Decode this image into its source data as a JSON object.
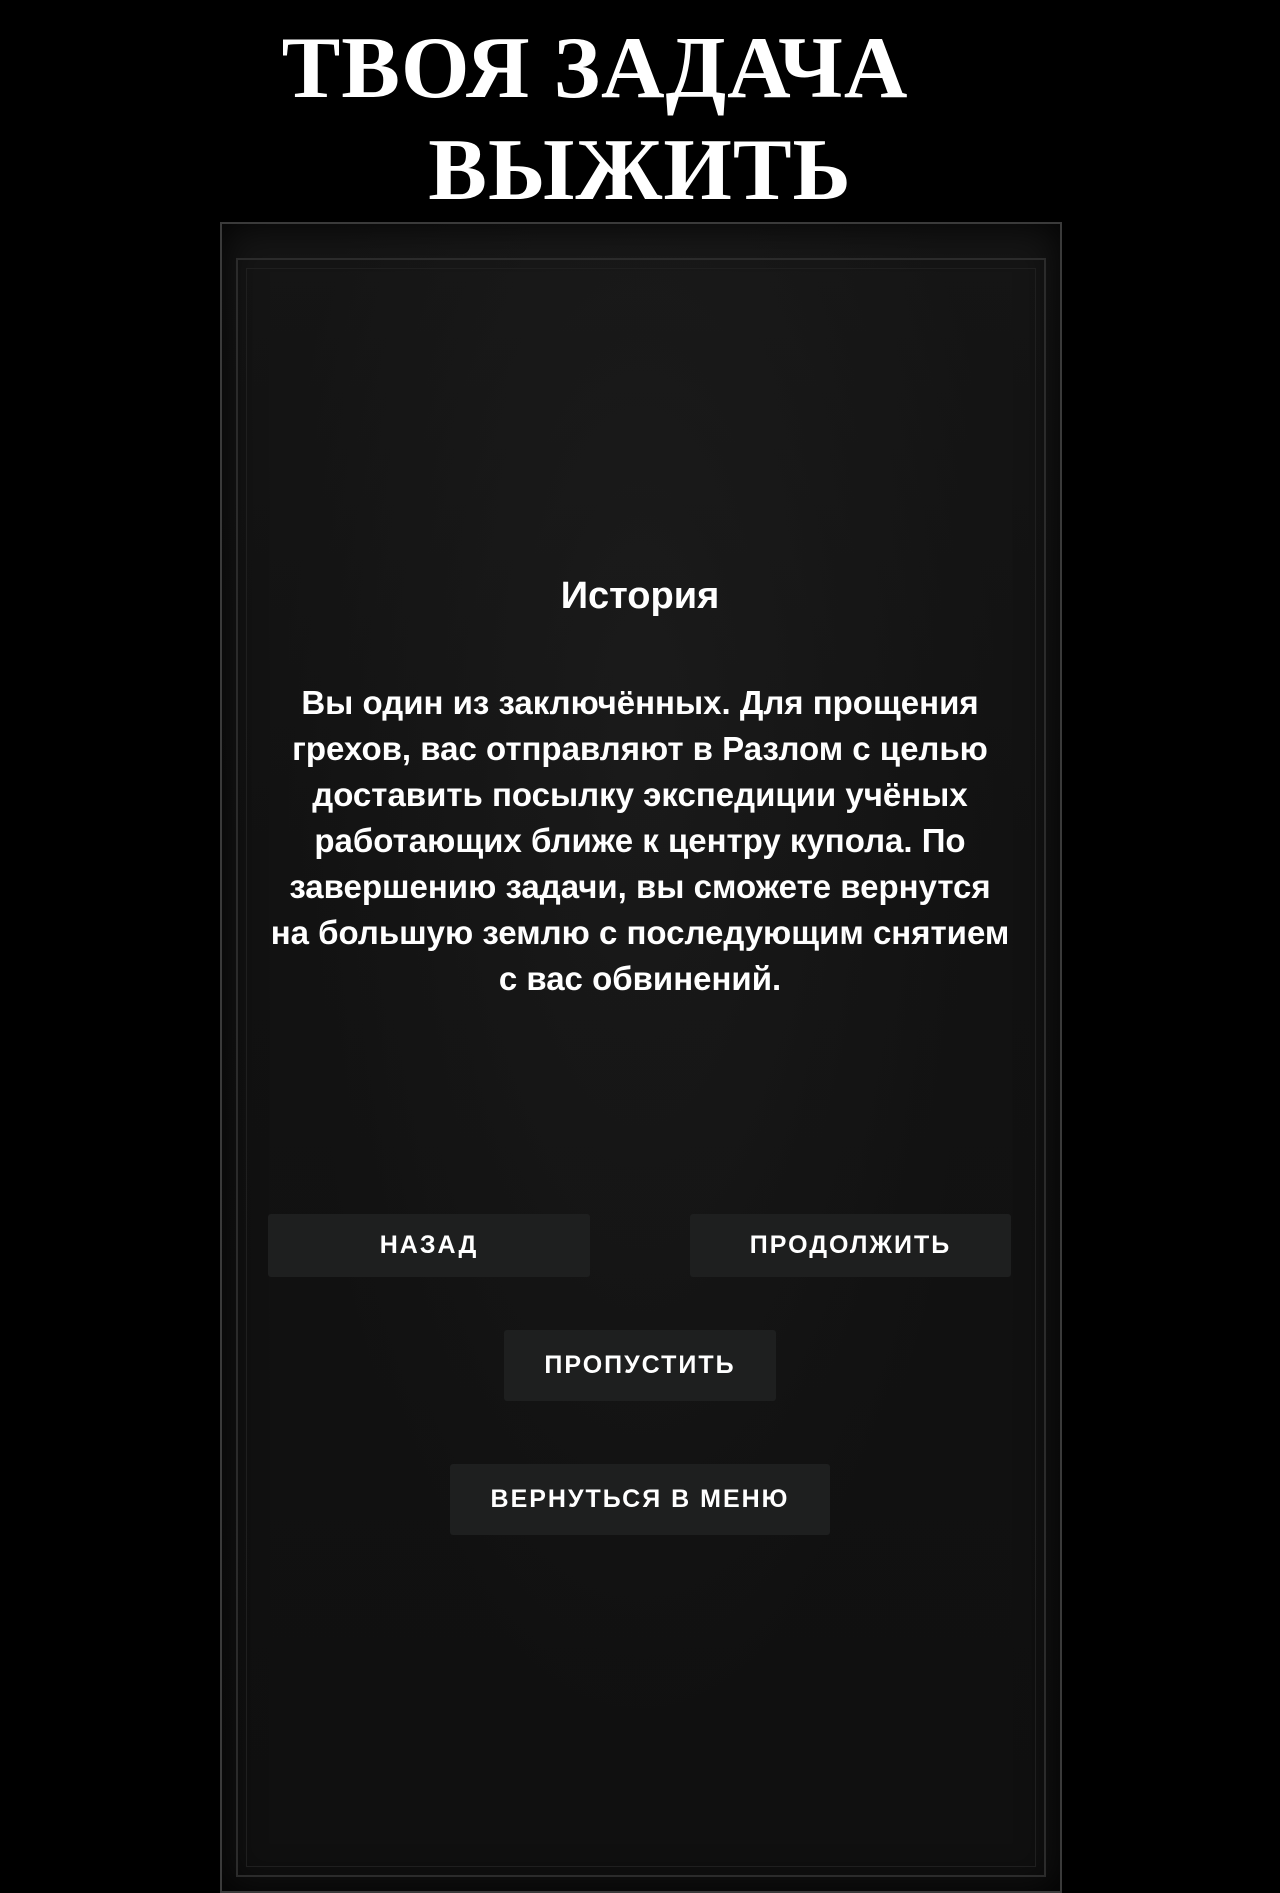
{
  "headline": {
    "line1": "ТВОЯ ЗАДАЧА",
    "line2": "ВЫЖИТЬ"
  },
  "story": {
    "title": "История",
    "text": "Вы один из заключённых. Для прощения грехов, вас отправляют в Разлом с целью доставить посылку экспедиции учёных работающих ближе к центру купола. По завершению задачи, вы сможете вернутся на большую землю с последующим снятием с вас обвинений."
  },
  "buttons": {
    "back": "НАЗАД",
    "continue": "ПРОДОЛЖИТЬ",
    "skip": "ПРОПУСТИТЬ",
    "menu": "ВЕРНУТЬСЯ В МЕНЮ"
  },
  "colors": {
    "background": "#000000",
    "panel": "#131313",
    "button": "#1e1f1f",
    "text": "#ffffff"
  }
}
